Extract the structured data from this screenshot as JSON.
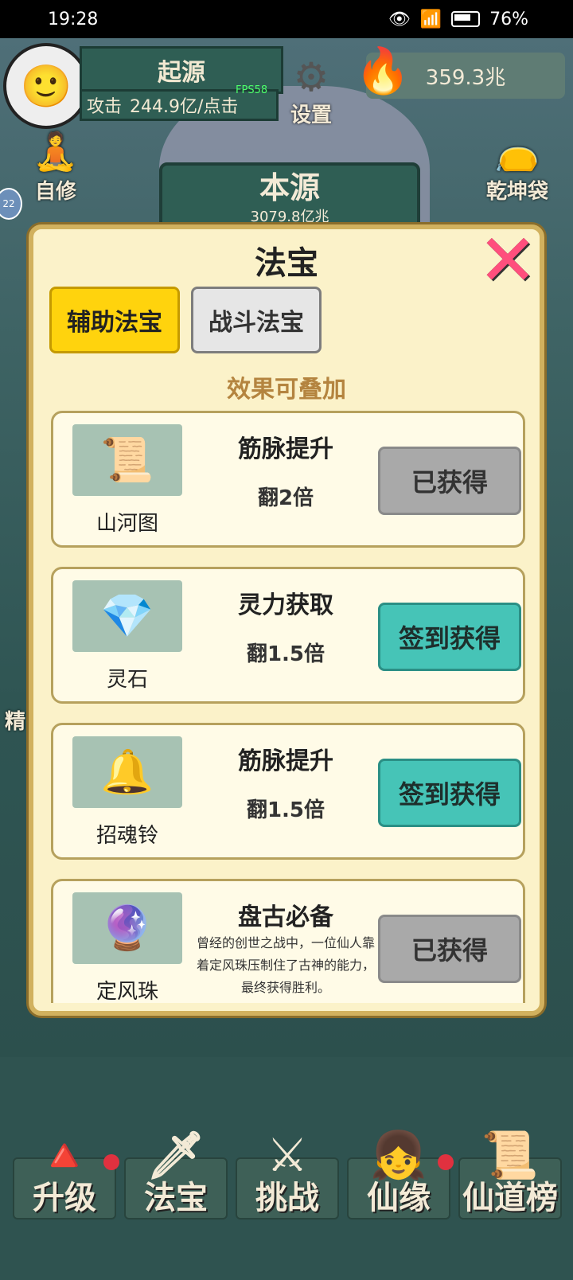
{
  "status_bar": {
    "time": "19:28",
    "battery": "76%"
  },
  "hud": {
    "player_name": "起源",
    "attack_label": "攻击",
    "attack_value": "244.9亿/点击",
    "fps": "FPS58",
    "settings_label": "设置",
    "currency": "359.3兆",
    "self_cultivate": "自修",
    "bag": "乾坤袋",
    "level_badge": "22",
    "origin_title": "本源",
    "origin_value": "3079.8亿兆"
  },
  "modal": {
    "title": "法宝",
    "tabs": [
      {
        "label": "辅助法宝"
      },
      {
        "label": "战斗法宝"
      }
    ],
    "subtitle": "效果可叠加",
    "items": [
      {
        "name": "山河图",
        "effect": "筋脉提升",
        "value": "翻2倍",
        "button": "已获得"
      },
      {
        "name": "灵石",
        "effect": "灵力获取",
        "value": "翻1.5倍",
        "button": "签到获得"
      },
      {
        "name": "招魂铃",
        "effect": "筋脉提升",
        "value": "翻1.5倍",
        "button": "签到获得"
      },
      {
        "name": "定风珠",
        "effect": "盘古必备",
        "desc": "曾经的创世之战中，一位仙人靠着定风珠压制住了古神的能力，最终获得胜利。",
        "button": "已获得"
      }
    ]
  },
  "bottom_nav": [
    {
      "label": "升级"
    },
    {
      "label": "法宝"
    },
    {
      "label": "挑战"
    },
    {
      "label": "仙缘"
    },
    {
      "label": "仙道榜"
    }
  ],
  "side_left_text": "精"
}
